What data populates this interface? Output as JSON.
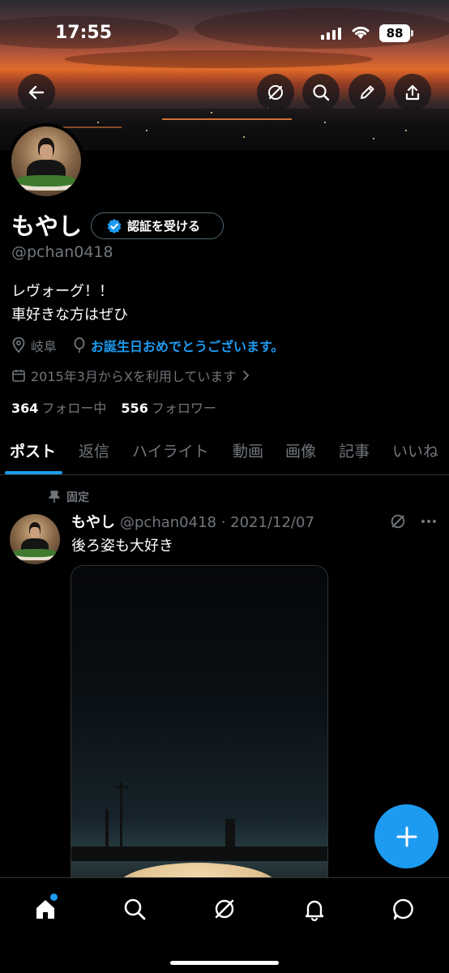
{
  "status_bar": {
    "time": "17:55",
    "battery": "88"
  },
  "header": {
    "back_icon": "arrow-left-icon",
    "actions": [
      "grok-icon",
      "search-icon",
      "edit-icon",
      "share-icon"
    ]
  },
  "profile": {
    "name": "もやし",
    "verify_label": "認証を受ける",
    "handle": "@pchan0418",
    "bio_lines": [
      "レヴォーグ！！",
      "車好きな方はぜひ"
    ],
    "location": "岐阜",
    "birthday_text": "お誕生日おめでとうございます。",
    "joined": "2015年3月からXを利用しています",
    "following_count": "364",
    "following_label": "フォロー中",
    "followers_count": "556",
    "followers_label": "フォロワー"
  },
  "tabs": [
    {
      "label": "ポスト",
      "active": true
    },
    {
      "label": "返信"
    },
    {
      "label": "ハイライト"
    },
    {
      "label": "動画"
    },
    {
      "label": "画像"
    },
    {
      "label": "記事"
    },
    {
      "label": "いいね"
    }
  ],
  "pinned_post": {
    "pinned_label": "固定",
    "author": "もやし",
    "handle": "@pchan0418",
    "date": "2021/12/07",
    "text": "後ろ姿も大好き"
  },
  "fab_icon": "plus-icon",
  "bottom_nav": [
    "home-icon",
    "search-icon",
    "grok-icon",
    "bell-icon",
    "messages-icon"
  ],
  "colors": {
    "accent": "#1d9bf0",
    "muted": "#71767b",
    "divider": "#2f3336"
  }
}
